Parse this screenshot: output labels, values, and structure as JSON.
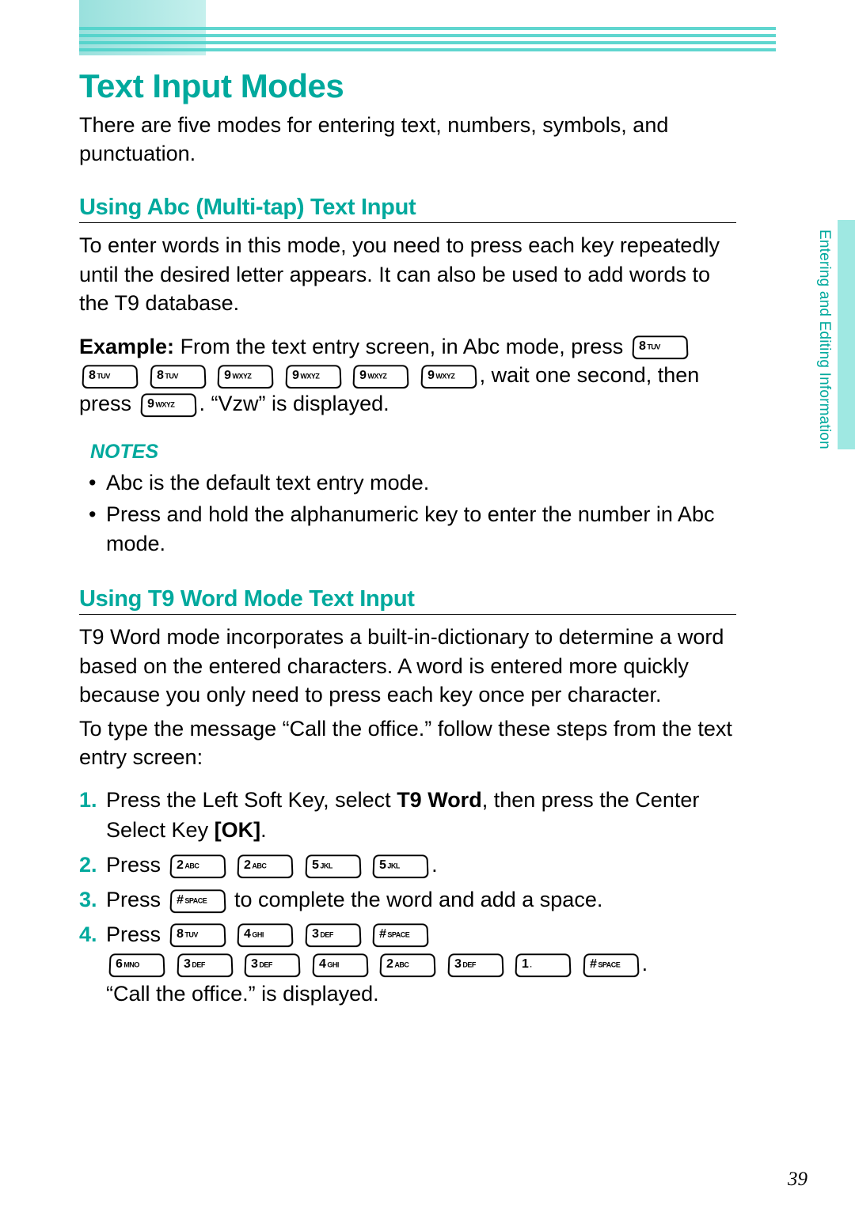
{
  "side_tab_label": "Entering and Editing Information",
  "page_number": "39",
  "h1": "Text Input Modes",
  "intro": "There are five modes for entering text, numbers, symbols, and punctuation.",
  "sec1_heading": "Using Abc (Multi-tap) Text Input",
  "sec1_para": "To enter words in this mode, you need to press each key repeatedly until the desired letter appears. It can also be used to add words to the T9 database.",
  "example_label": "Example:",
  "example_lead": " From the text entry screen, in Abc mode, press ",
  "example_keys_1": [
    "8 TUV",
    "8 TUV",
    "8 TUV",
    "9 WXYZ",
    "9 WXYZ",
    "9 WXYZ",
    "9 WXYZ"
  ],
  "example_mid": ", wait one second, then press ",
  "example_keys_2": [
    "9 WXYZ"
  ],
  "example_tail": ". “Vzw” is displayed.",
  "notes_label": "NOTES",
  "notes": [
    "Abc is the default text entry mode.",
    "Press and hold the alphanumeric key to enter the number in Abc mode."
  ],
  "sec2_heading": "Using T9 Word Mode Text Input",
  "sec2_para1": "T9 Word mode incorporates a built-in-dictionary to determine a word based on the entered characters. A word is entered more quickly because you only need to press each key once per character.",
  "sec2_para2": "To type the message “Call the office.” follow these steps from the text entry screen:",
  "steps": {
    "s1_a": "Press the Left Soft Key, select ",
    "s1_bold1": "T9 Word",
    "s1_b": ", then press the Center Select Key ",
    "s1_bold2": "[OK]",
    "s1_c": ".",
    "s2_a": "Press ",
    "s2_keys": [
      "2 ABC",
      "2 ABC",
      "5 JKL",
      "5 JKL"
    ],
    "s2_b": ".",
    "s3_a": "Press ",
    "s3_keys": [
      "# SPACE"
    ],
    "s3_b": " to complete the word and add a space.",
    "s4_a": "Press ",
    "s4_keys_line1": [
      "8 TUV",
      "4 GHI",
      "3 DEF",
      "# SPACE"
    ],
    "s4_keys_line2": [
      "6 MNO",
      "3 DEF",
      "3 DEF",
      "4 GHI",
      "2 ABC",
      "3 DEF",
      "1 .",
      "# SPACE"
    ],
    "s4_b": ".",
    "s4_result": "“Call the office.” is displayed."
  }
}
